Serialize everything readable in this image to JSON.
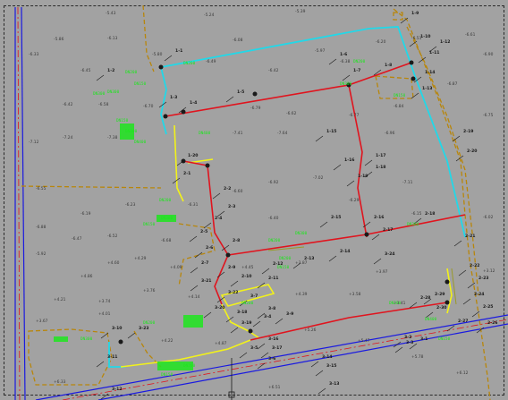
{
  "document_title": "",
  "colors": {
    "background": "#a2a2a2",
    "frame": "#2a2a2a",
    "red_line": "#e0141e",
    "cyan_line": "#22d8e8",
    "yellow_line": "#f2f21a",
    "blue_road": "#1a1ae0",
    "orange_boundary": "#b8860b",
    "green_label": "#1ee61e",
    "point_label": "#1a1a1a",
    "elevation_text": "#3a3a3a"
  },
  "elevation_labels": [
    "-5.43",
    "-5.24",
    "-5.39",
    "-5.86",
    "-6.13",
    "-6.08",
    "-5.97",
    "-6.20",
    "-6.33",
    "-6.45",
    "-5.80",
    "-6.49",
    "-6.42",
    "-6.38",
    "-6.51",
    "-6.61",
    "-6.42",
    "-6.58",
    "-6.70",
    "-6.79",
    "-6.62",
    "-6.77",
    "-6.84",
    "-6.90",
    "-7.12",
    "-7.24",
    "-7.38",
    "-7.41",
    "-7.64",
    "-6.96",
    "-6.87",
    "-6.75",
    "-6.55",
    "-6.19",
    "-6.23",
    "-6.31",
    "-6.60",
    "-6.92",
    "-7.02",
    "-7.11",
    "-6.88",
    "-6.47",
    "-6.52",
    "-6.68",
    "-6.40",
    "-6.29",
    "-6.15",
    "-6.02",
    "-5.92",
    "+4.86",
    "+4.60",
    "+4.29",
    "+4.09",
    "+4.45",
    "+3.87",
    "+3.97",
    "+4.21",
    "+3.74",
    "+3.76",
    "+4.14",
    "+4.39",
    "+3.58",
    "+3.41",
    "+3.12",
    "+3.67",
    "+4.01",
    "+4.22",
    "+4.87",
    "+5.26",
    "+5.47",
    "+5.78",
    "+6.12",
    "+6.33",
    "+6.51"
  ],
  "point_labels": [
    "1-1",
    "1-2",
    "1-3",
    "1-4",
    "1-5",
    "1-6",
    "1-7",
    "1-8",
    "1-9",
    "1-10",
    "1-11",
    "1-12",
    "1-13",
    "1-14",
    "1-15",
    "1-16",
    "1-17",
    "1-18",
    "1-19",
    "1-20",
    "2-1",
    "2-2",
    "2-3",
    "2-4",
    "2-5",
    "2-6",
    "2-7",
    "2-8",
    "2-9",
    "2-10",
    "2-11",
    "2-12",
    "2-13",
    "2-14",
    "2-15",
    "2-16",
    "2-17",
    "2-18",
    "2-19",
    "2-20",
    "2-21",
    "2-22",
    "2-23",
    "2-24",
    "2-25",
    "2-26",
    "2-27",
    "2-28",
    "2-29",
    "2-30",
    "3-1",
    "3-2",
    "3-3",
    "3-4",
    "3-5",
    "3-6",
    "3-7",
    "3-8",
    "3-9",
    "3-10",
    "3-11",
    "3-12",
    "3-13",
    "3-14",
    "3-15",
    "3-16",
    "3-17",
    "3-18",
    "3-19",
    "3-20",
    "3-21",
    "3-22",
    "3-23",
    "3-24"
  ],
  "green_labels": [
    "DN200",
    "DN200",
    "DN300",
    "DN300",
    "DN150",
    "DN150",
    "DN200",
    "DN400",
    "DN400",
    "DN200",
    "DN300",
    "DN150",
    "DN200",
    "DN300",
    "DN200",
    "DN150",
    "DN200",
    "DN300",
    "DN200",
    "DN150",
    "DN300",
    "DN200",
    "DN400",
    "DN150",
    "DN200",
    "DN300",
    "DN200",
    "DN150"
  ]
}
